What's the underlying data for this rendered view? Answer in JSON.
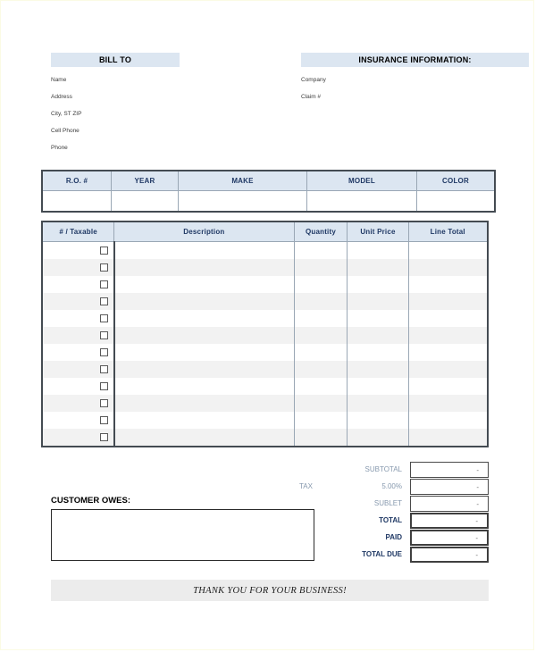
{
  "document": {
    "type": "auto-repair-invoice-form",
    "footer_text": "THANK YOU FOR YOUR BUSINESS!"
  },
  "bill_to": {
    "heading": "BILL TO",
    "fields": [
      {
        "label": "Name",
        "value": ""
      },
      {
        "label": "Address",
        "value": ""
      },
      {
        "label": "City, ST ZIP",
        "value": ""
      },
      {
        "label": "Cell Phone",
        "value": ""
      },
      {
        "label": "Phone",
        "value": ""
      }
    ]
  },
  "insurance": {
    "heading": "INSURANCE INFORMATION:",
    "fields": [
      {
        "label": "Company",
        "value": ""
      },
      {
        "label": "Claim #",
        "value": ""
      }
    ]
  },
  "vehicle_table": {
    "headers": [
      "R.O. #",
      "YEAR",
      "MAKE",
      "MODEL",
      "COLOR"
    ],
    "rows": [
      {
        "ro": "",
        "year": "",
        "make": "",
        "model": "",
        "color": ""
      }
    ]
  },
  "items_table": {
    "headers": [
      "# / Taxable",
      "Description",
      "Quantity",
      "Unit Price",
      "Line Total"
    ],
    "row_count": 12,
    "rows": [
      {
        "taxable": false,
        "description": "",
        "quantity": "",
        "unit_price": "",
        "line_total": ""
      },
      {
        "taxable": false,
        "description": "",
        "quantity": "",
        "unit_price": "",
        "line_total": ""
      },
      {
        "taxable": false,
        "description": "",
        "quantity": "",
        "unit_price": "",
        "line_total": ""
      },
      {
        "taxable": false,
        "description": "",
        "quantity": "",
        "unit_price": "",
        "line_total": ""
      },
      {
        "taxable": false,
        "description": "",
        "quantity": "",
        "unit_price": "",
        "line_total": ""
      },
      {
        "taxable": false,
        "description": "",
        "quantity": "",
        "unit_price": "",
        "line_total": ""
      },
      {
        "taxable": false,
        "description": "",
        "quantity": "",
        "unit_price": "",
        "line_total": ""
      },
      {
        "taxable": false,
        "description": "",
        "quantity": "",
        "unit_price": "",
        "line_total": ""
      },
      {
        "taxable": false,
        "description": "",
        "quantity": "",
        "unit_price": "",
        "line_total": ""
      },
      {
        "taxable": false,
        "description": "",
        "quantity": "",
        "unit_price": "",
        "line_total": ""
      },
      {
        "taxable": false,
        "description": "",
        "quantity": "",
        "unit_price": "",
        "line_total": ""
      },
      {
        "taxable": false,
        "description": "",
        "quantity": "",
        "unit_price": "",
        "line_total": ""
      }
    ]
  },
  "totals": {
    "rows": [
      {
        "prefix": "",
        "label": "SUBTOTAL",
        "value": "-",
        "strong": false
      },
      {
        "prefix": "TAX",
        "label": "5.00%",
        "value": "-",
        "strong": false
      },
      {
        "prefix": "",
        "label": "SUBLET",
        "value": "-",
        "strong": false
      },
      {
        "prefix": "",
        "label": "TOTAL",
        "value": "-",
        "strong": true
      },
      {
        "prefix": "",
        "label": "PAID",
        "value": "-",
        "strong": true
      },
      {
        "prefix": "",
        "label": "TOTAL DUE",
        "value": "-",
        "strong": true
      }
    ],
    "tax_rate": "5.00%"
  },
  "customer_owes": {
    "title": "CUSTOMER OWES:",
    "value": ""
  },
  "colors": {
    "band_blue": "#dce6f1",
    "header_text": "#1f3864",
    "muted_label": "#8799ae",
    "stripe": "#f2f2f2",
    "footer_band": "#ececec",
    "border": "#444b52"
  }
}
